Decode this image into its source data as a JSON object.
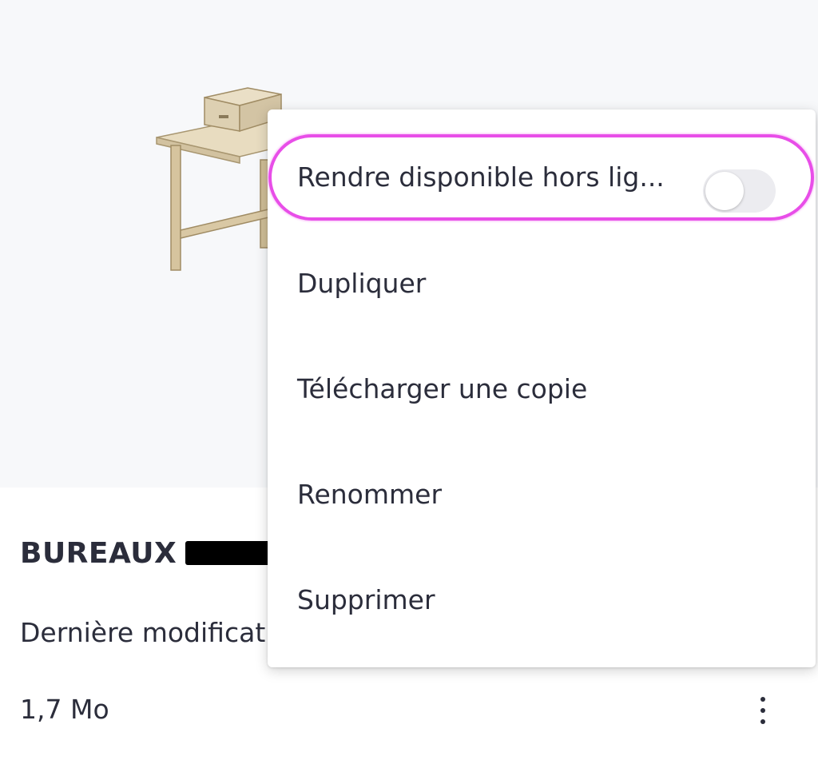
{
  "file": {
    "title": "BUREAUX",
    "modified": "Dernière modificat",
    "size": "1,7 Mo"
  },
  "menu": {
    "offline_label": "Rendre disponible hors lig...",
    "offline_enabled": false,
    "duplicate_label": "Dupliquer",
    "download_label": "Télécharger une copie",
    "rename_label": "Renommer",
    "delete_label": "Supprimer"
  },
  "colors": {
    "highlight": "#e84ee8",
    "text": "#2b2d3b",
    "thumbnail_bg": "#f7f8fa"
  }
}
